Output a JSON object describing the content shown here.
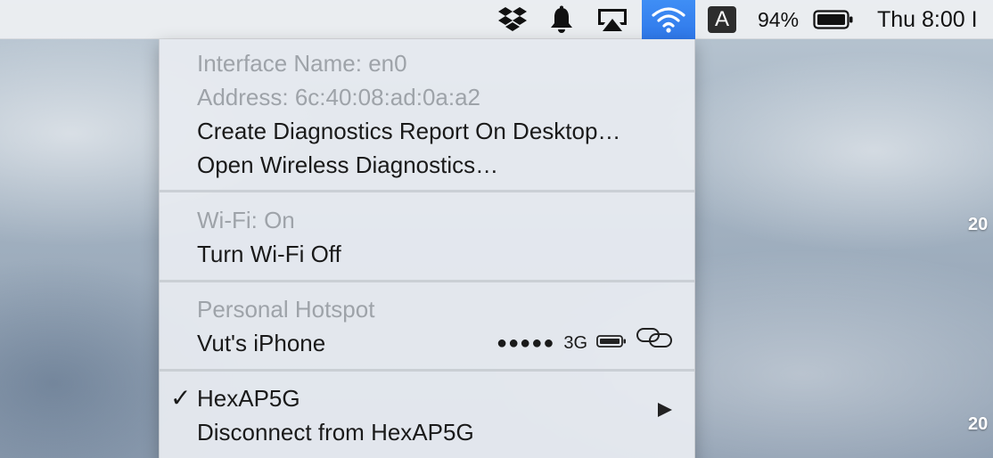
{
  "menubar": {
    "icons": [
      "dropbox-icon",
      "notification-bell-icon",
      "airplay-icon",
      "wifi-icon",
      "input-source-icon",
      "battery-icon"
    ],
    "input_source": "A",
    "battery_percent": "94%",
    "clock": "Thu 8:00 I"
  },
  "desktop": {
    "label_top": "20",
    "label_bottom": "20"
  },
  "menu": {
    "interface_name": "Interface Name: en0",
    "address": "Address: 6c:40:08:ad:0a:a2",
    "create_report": "Create Diagnostics Report On Desktop…",
    "open_diagnostics": "Open Wireless Diagnostics…",
    "wifi_status": "Wi-Fi: On",
    "turn_off": "Turn Wi-Fi Off",
    "hotspot_header": "Personal Hotspot",
    "hotspot_device": "Vut's iPhone",
    "hotspot_signal": "●●●●●",
    "hotspot_network": "3G",
    "network_name": "HexAP5G",
    "network_checked": "✓",
    "disconnect": "Disconnect from HexAP5G"
  },
  "colors": {
    "wifi_highlight": "#3f8ef5",
    "disabled_text": "#9ea3a9"
  }
}
